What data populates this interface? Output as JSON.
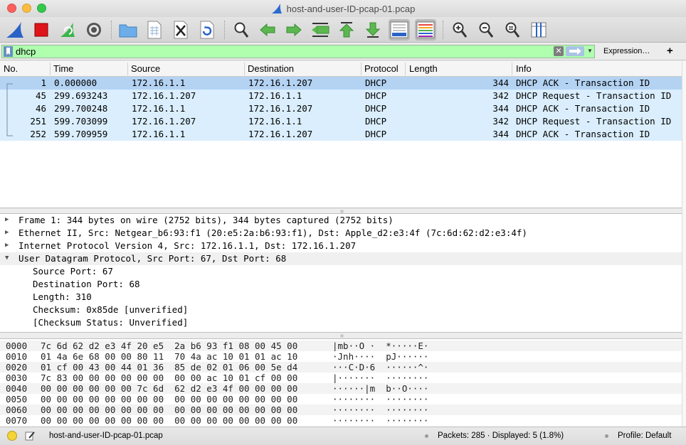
{
  "window": {
    "title": "host-and-user-ID-pcap-01.pcap"
  },
  "toolbar": {
    "buttons": [
      {
        "icon": "shark-fin-start-icon"
      },
      {
        "icon": "stop-capture-icon"
      },
      {
        "icon": "restart-capture-icon"
      },
      {
        "icon": "capture-options-gear-icon"
      },
      {
        "icon": "open-folder-icon"
      },
      {
        "icon": "save-file-icon"
      },
      {
        "icon": "close-file-icon"
      },
      {
        "icon": "reload-icon"
      },
      {
        "icon": "find-packet-icon"
      },
      {
        "icon": "go-back-icon"
      },
      {
        "icon": "go-forward-icon"
      },
      {
        "icon": "go-to-packet-icon"
      },
      {
        "icon": "go-first-icon"
      },
      {
        "icon": "go-last-icon"
      },
      {
        "icon": "autoscroll-icon"
      },
      {
        "icon": "colorize-icon"
      },
      {
        "icon": "zoom-in-icon"
      },
      {
        "icon": "zoom-out-icon"
      },
      {
        "icon": "normal-size-icon"
      },
      {
        "icon": "resize-columns-icon"
      }
    ]
  },
  "filter": {
    "value": "dhcp",
    "expression_label": "Expression…",
    "plus_label": "+",
    "bg_color": "#afffaf"
  },
  "packet_list": {
    "columns": [
      "No.",
      "Time",
      "Source",
      "Destination",
      "Protocol",
      "Length",
      "Info"
    ],
    "rows": [
      {
        "no": "1",
        "time": "0.000000",
        "source": "172.16.1.1",
        "destination": "172.16.1.207",
        "protocol": "DHCP",
        "length": "344",
        "info": "DHCP ACK      - Transaction ID"
      },
      {
        "no": "45",
        "time": "299.693243",
        "source": "172.16.1.207",
        "destination": "172.16.1.1",
        "protocol": "DHCP",
        "length": "342",
        "info": "DHCP Request  - Transaction ID"
      },
      {
        "no": "46",
        "time": "299.700248",
        "source": "172.16.1.1",
        "destination": "172.16.1.207",
        "protocol": "DHCP",
        "length": "344",
        "info": "DHCP ACK      - Transaction ID"
      },
      {
        "no": "251",
        "time": "599.703099",
        "source": "172.16.1.207",
        "destination": "172.16.1.1",
        "protocol": "DHCP",
        "length": "342",
        "info": "DHCP Request  - Transaction ID"
      },
      {
        "no": "252",
        "time": "599.709959",
        "source": "172.16.1.1",
        "destination": "172.16.1.207",
        "protocol": "DHCP",
        "length": "344",
        "info": "DHCP ACK      - Transaction ID"
      }
    ],
    "selected_index": 0,
    "row_color": "#daeefd",
    "selected_color": "#b4d3f3"
  },
  "details": {
    "rows": [
      {
        "arrow": "▶",
        "text": "Frame 1: 344 bytes on wire (2752 bits), 344 bytes captured (2752 bits)",
        "child": false
      },
      {
        "arrow": "▶",
        "text": "Ethernet II, Src: Netgear_b6:93:f1 (20:e5:2a:b6:93:f1), Dst: Apple_d2:e3:4f (7c:6d:62:d2:e3:4f)",
        "child": false
      },
      {
        "arrow": "▶",
        "text": "Internet Protocol Version 4, Src: 172.16.1.1, Dst: 172.16.1.207",
        "child": false
      },
      {
        "arrow": "▼",
        "text": "User Datagram Protocol, Src Port: 67, Dst Port: 68",
        "child": false
      },
      {
        "arrow": "",
        "text": "Source Port: 67",
        "child": true
      },
      {
        "arrow": "",
        "text": "Destination Port: 68",
        "child": true
      },
      {
        "arrow": "",
        "text": "Length: 310",
        "child": true
      },
      {
        "arrow": "",
        "text": "Checksum: 0x85de [unverified]",
        "child": true
      },
      {
        "arrow": "",
        "text": "[Checksum Status: Unverified]",
        "child": true
      }
    ]
  },
  "bytes": {
    "rows": [
      {
        "offset": "0000",
        "hex": "7c 6d 62 d2 e3 4f 20 e5  2a b6 93 f1 08 00 45 00",
        "ascii": "|mb··O ·  *·····E·"
      },
      {
        "offset": "0010",
        "hex": "01 4a 6e 68 00 00 80 11  70 4a ac 10 01 01 ac 10",
        "ascii": "·Jnh····  pJ······"
      },
      {
        "offset": "0020",
        "hex": "01 cf 00 43 00 44 01 36  85 de 02 01 06 00 5e d4",
        "ascii": "···C·D·6  ······^·"
      },
      {
        "offset": "0030",
        "hex": "7c 83 00 00 00 00 00 00  00 00 ac 10 01 cf 00 00",
        "ascii": "|·······  ········"
      },
      {
        "offset": "0040",
        "hex": "00 00 00 00 00 00 7c 6d  62 d2 e3 4f 00 00 00 00",
        "ascii": "······|m  b··O····"
      },
      {
        "offset": "0050",
        "hex": "00 00 00 00 00 00 00 00  00 00 00 00 00 00 00 00",
        "ascii": "········  ········"
      },
      {
        "offset": "0060",
        "hex": "00 00 00 00 00 00 00 00  00 00 00 00 00 00 00 00",
        "ascii": "········  ········"
      },
      {
        "offset": "0070",
        "hex": "00 00 00 00 00 00 00 00  00 00 00 00 00 00 00 00",
        "ascii": "········  ········"
      }
    ]
  },
  "status": {
    "file": "host-and-user-ID-pcap-01.pcap",
    "packets": "Packets: 285 · Displayed: 5 (1.8%)",
    "profile": "Profile: Default"
  }
}
